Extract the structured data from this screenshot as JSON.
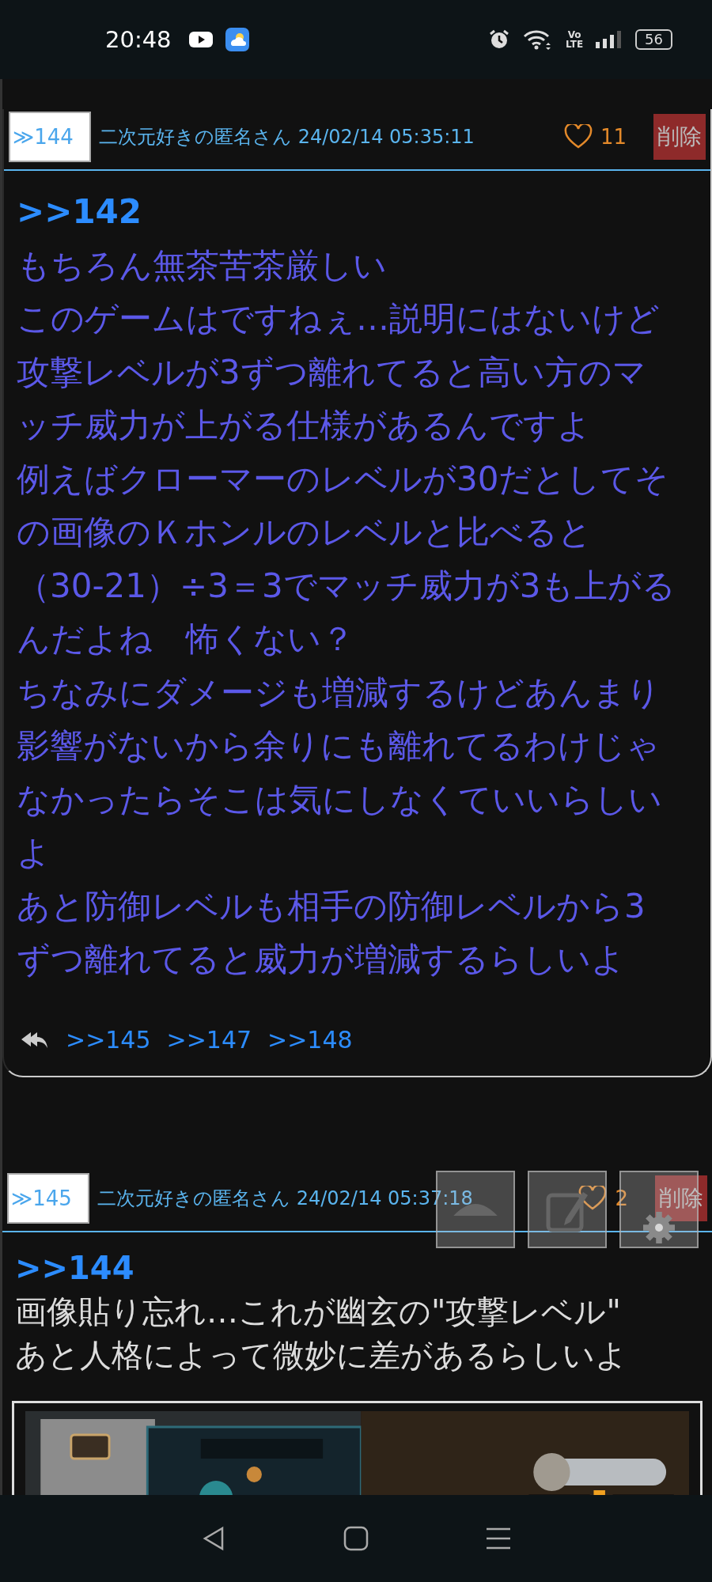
{
  "status_bar": {
    "time": "20:48",
    "network": [
      "Vo",
      "LTE"
    ],
    "battery": "56"
  },
  "posts": [
    {
      "number": "≫144",
      "author": "二次元好きの匿名さん",
      "date": "24/02/14 05:35:11",
      "likes": "11",
      "delete_label": "削除",
      "quote": ">>142",
      "color": "#5b58e8",
      "lines": [
        "もちろん無茶苦茶厳しい",
        "このゲームはですねぇ…説明にはないけど",
        "攻撃レベルが3ずつ離れてると高い方のマ",
        "ッチ威力が上がる仕様があるんですよ",
        "例えばクローマーのレベルが30だとしてそ",
        "の画像のＫホンルのレベルと比べると",
        "（30-21）÷3＝3でマッチ威力が3も上がる",
        "んだよね　怖くない？",
        "ちなみにダメージも増減するけどあんまり",
        "影響がないから余りにも離れてるわけじゃ",
        "なかったらそこは気にしなくていいらしい",
        "よ",
        "あと防御レベルも相手の防御レベルから3",
        "ずつ離れてると威力が増減するらしいよ"
      ],
      "replies": [
        ">>145",
        ">>147",
        ">>148"
      ]
    },
    {
      "number": "≫145",
      "author": "二次元好きの匿名さん",
      "date": "24/02/14 05:37:18",
      "likes": "2",
      "delete_label": "削除",
      "quote": ">>144",
      "color": "#dcdcdc",
      "lines": [
        "画像貼り忘れ…これが幽玄の\"攻撃レベル\"",
        "あと人格によって微妙に差があるらしいよ"
      ],
      "image": {
        "kind": "picture"
      }
    }
  ]
}
